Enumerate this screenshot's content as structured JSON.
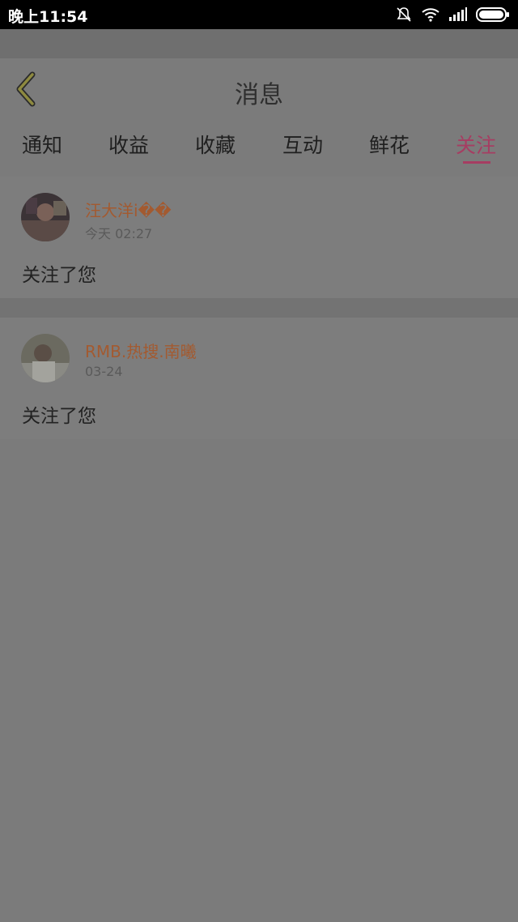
{
  "statusbar": {
    "time": "晚上11:54"
  },
  "header": {
    "title": "消息"
  },
  "tabs": [
    {
      "label": "通知"
    },
    {
      "label": "收益"
    },
    {
      "label": "收藏"
    },
    {
      "label": "互动"
    },
    {
      "label": "鲜花"
    },
    {
      "label": "关注",
      "active": true
    }
  ],
  "items": [
    {
      "name": "汪大洋i��",
      "time": "今天 02:27",
      "message": "关注了您"
    },
    {
      "name": "RMB.热搜.南曦",
      "time": "03-24",
      "message": "关注了您"
    }
  ],
  "colors": {
    "accent": "#a63d62",
    "name": "#a35a30",
    "overlay": "#7b7b7b"
  },
  "icons": [
    "bell-muted-icon",
    "wifi-icon",
    "signal-icon",
    "battery-icon",
    "back-chevron-icon"
  ]
}
